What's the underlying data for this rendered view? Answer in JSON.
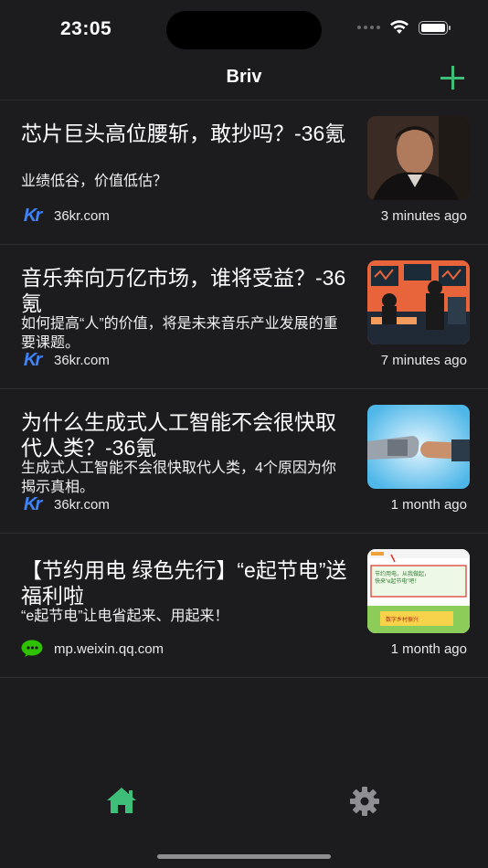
{
  "status_bar": {
    "time": "23:05"
  },
  "nav": {
    "title": "Briv"
  },
  "feed": [
    {
      "title": "芯片巨头高位腰斩，敢抄吗？-36氪",
      "summary": "业绩低谷，价值低估？",
      "source": "36kr.com",
      "time_ago": "3 minutes ago",
      "source_icon": "36kr-logo-icon"
    },
    {
      "title": "音乐奔向万亿市场，谁将受益？-36氪",
      "summary": "如何提高“人”的价值，将是未来音乐产业发展的重要课题。",
      "source": "36kr.com",
      "time_ago": "7 minutes ago",
      "source_icon": "36kr-logo-icon"
    },
    {
      "title": "为什么生成式人工智能不会很快取代人类？-36氪",
      "summary": "生成式人工智能不会很快取代人类，4个原因为你揭示真相。",
      "source": "36kr.com",
      "time_ago": "1 month ago",
      "source_icon": "36kr-logo-icon"
    },
    {
      "title": "【节约用电 绿色先行】“e起节电”送福利啦",
      "summary": "“e起节电”让电省起来、用起来！",
      "source": "mp.weixin.qq.com",
      "time_ago": "1 month ago",
      "source_icon": "wechat-logo-icon"
    }
  ],
  "thumb4": {
    "line1": "节约用电，从我做起，",
    "line2": "快来“e起节电”吧！",
    "banner": "数字乡村振兴"
  },
  "source_logo_text": "Kr",
  "tab_bar": {
    "home_icon": "home-icon",
    "settings_icon": "gear-icon"
  },
  "colors": {
    "accent": "#3dbf7a",
    "background": "#1c1c1e",
    "kr_blue": "#3f83f8",
    "wechat_green": "#2dc100"
  }
}
